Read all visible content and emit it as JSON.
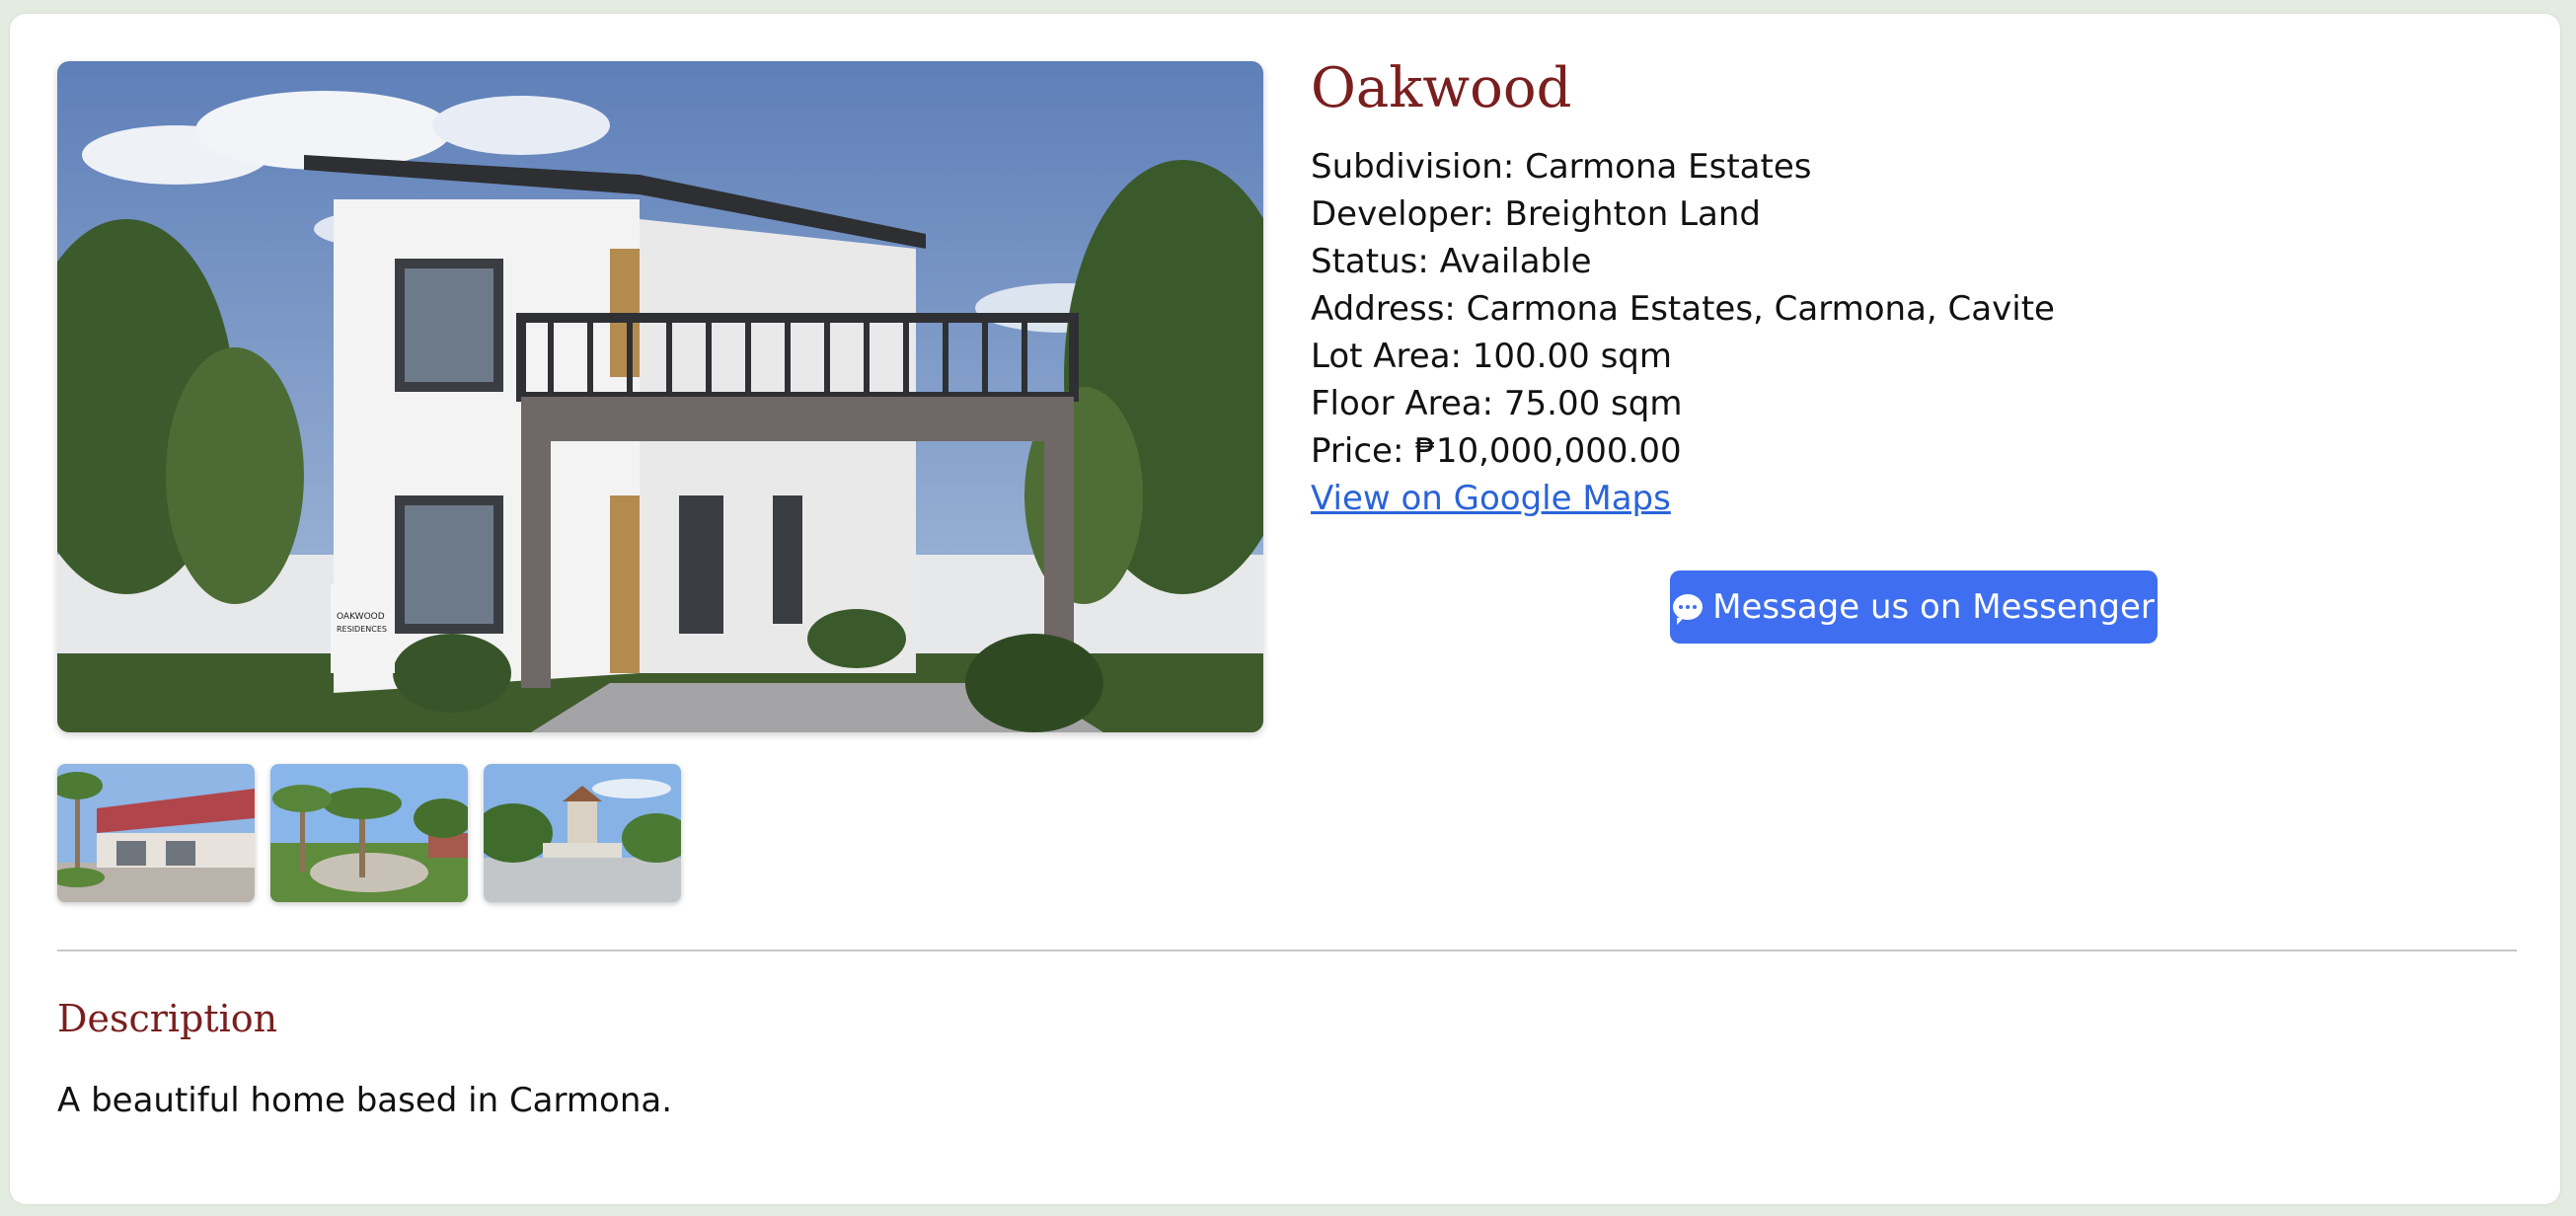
{
  "property": {
    "title": "Oakwood",
    "fields": [
      "Subdivision: Carmona Estates",
      "Developer: Breighton Land",
      "Status: Available",
      "Address: Carmona Estates, Carmona, Cavite",
      "Lot Area: 100.00 sqm",
      "Floor Area: 75.00 sqm",
      "Price: ₱10,000,000.00"
    ],
    "maps_link": "View on Google Maps"
  },
  "messenger": {
    "label": "Message us on Messenger",
    "color": "#3f6ff0"
  },
  "gallery": {
    "main_sign_line1": "OAKWOOD",
    "main_sign_line2": "RESIDENCES",
    "thumbnails": [
      "gate-thumbnail",
      "park-thumbnail",
      "street-thumbnail"
    ]
  },
  "description": {
    "heading": "Description",
    "text": "A beautiful home based in Carmona."
  },
  "colors": {
    "accent": "#7a1e1e",
    "link": "#2a63d8",
    "background": "#e4ebe0"
  }
}
